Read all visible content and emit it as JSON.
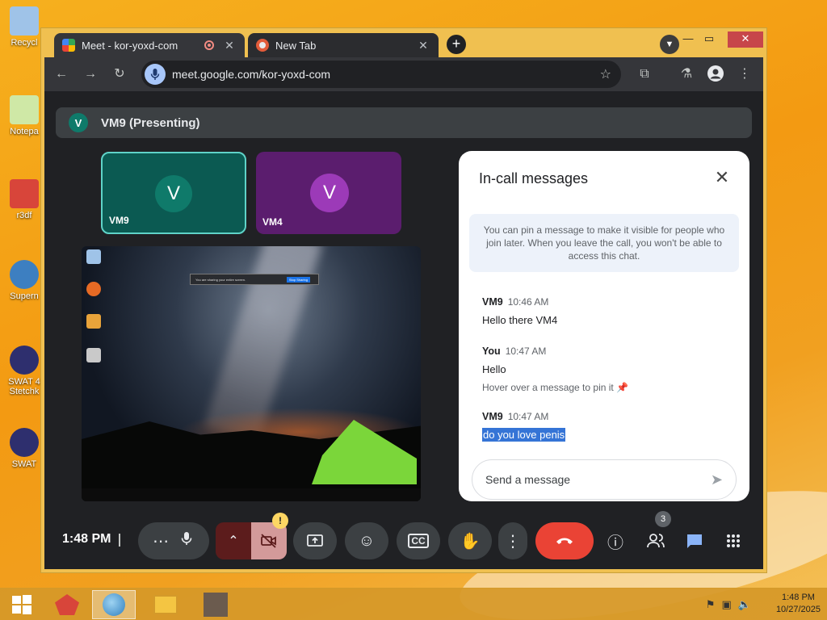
{
  "desktop": {
    "icons": [
      {
        "label": "Recycl",
        "color": "#9fc3e8"
      },
      {
        "label": "Notepa",
        "color": "#cfe8a6"
      },
      {
        "label": "r3df",
        "color": "#d8453a"
      },
      {
        "label": "Supern",
        "color": "#3d7fc1"
      },
      {
        "label": "SWAT 4 Stetchk",
        "color": "#2e2f6e"
      },
      {
        "label": "SWAT",
        "color": "#2e2f6e"
      }
    ]
  },
  "browser": {
    "tabs": [
      {
        "title": "Meet - kor-yoxd-com",
        "close": "✕"
      },
      {
        "title": "New Tab",
        "close": "✕"
      }
    ],
    "new_tab": "+",
    "url": "meet.google.com/kor-yoxd-com"
  },
  "meet": {
    "presenter": {
      "initial": "V",
      "label": "VM9 (Presenting)"
    },
    "tiles": [
      {
        "initial": "V",
        "name": "VM9",
        "bg": "#0b5a52",
        "avatar": "#0f7a6a",
        "border": "#5fd3c8"
      },
      {
        "initial": "V",
        "name": "VM4",
        "bg": "#5b1d6e",
        "avatar": "#9c3ab8",
        "border": "#5b1d6e"
      }
    ],
    "shared_screen": {
      "banner_text": "You are sharing your entire screen.",
      "banner_button": "Stop Sharing"
    },
    "chat": {
      "title": "In-call messages",
      "notice": "You can pin a message to make it visible for people who join later. When you leave the call, you won't be able to access this chat.",
      "messages": [
        {
          "sender": "VM9",
          "time": "10:46 AM",
          "text": "Hello there VM4"
        },
        {
          "sender": "You",
          "time": "10:47 AM",
          "text": "Hello",
          "hint": "Hover over a message to pin it"
        },
        {
          "sender": "VM9",
          "time": "10:47 AM",
          "text": "do you love penis"
        }
      ],
      "input_placeholder": "Send a message"
    },
    "controls": {
      "clock": "1:48 PM",
      "people_count": "3",
      "warning": "!"
    }
  },
  "taskbar": {
    "time": "1:48 PM",
    "date": "10/27/2025"
  }
}
